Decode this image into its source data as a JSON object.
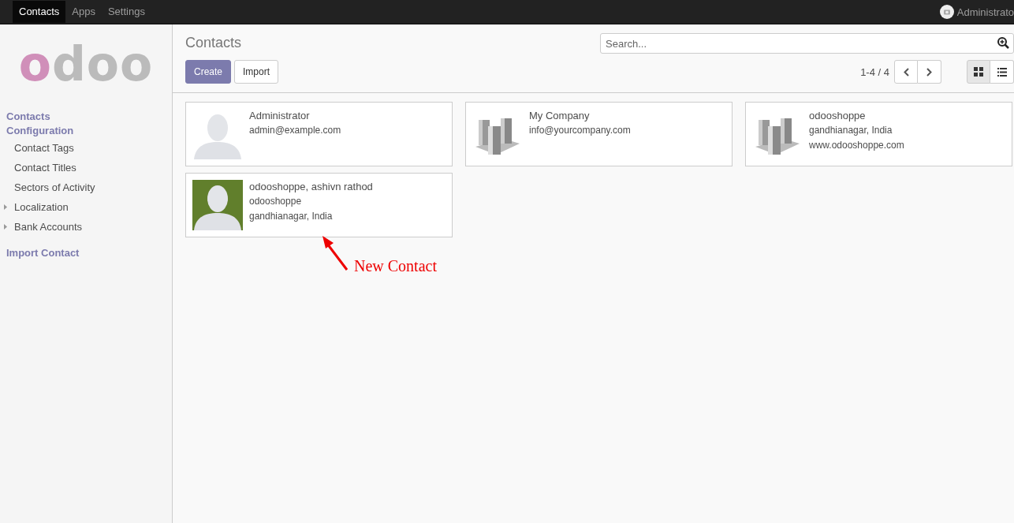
{
  "navbar": {
    "menus": [
      {
        "label": "Contacts",
        "selected": true
      },
      {
        "label": "Apps",
        "selected": false
      },
      {
        "label": "Settings",
        "selected": false
      }
    ],
    "user": "Administrato"
  },
  "sidebar": {
    "logo": "odoo",
    "sections": [
      {
        "kind": "header",
        "label": "Contacts"
      },
      {
        "kind": "header",
        "label": "Configuration"
      },
      {
        "kind": "item",
        "label": "Contact Tags",
        "expandable": false
      },
      {
        "kind": "item",
        "label": "Contact Titles",
        "expandable": false
      },
      {
        "kind": "item",
        "label": "Sectors of Activity",
        "expandable": false
      },
      {
        "kind": "item",
        "label": "Localization",
        "expandable": true
      },
      {
        "kind": "item",
        "label": "Bank Accounts",
        "expandable": true
      },
      {
        "kind": "header",
        "label": "Import Contact"
      }
    ]
  },
  "control_panel": {
    "title": "Contacts",
    "buttons": [
      {
        "label": "Create",
        "kind": "primary"
      },
      {
        "label": "Import",
        "kind": "secondary"
      }
    ],
    "search": {
      "placeholder": "Search..."
    },
    "pager": "1-4 / 4",
    "views": [
      {
        "kind": "kanban",
        "selected": true
      },
      {
        "kind": "list",
        "selected": false
      }
    ]
  },
  "cards": [
    {
      "kind": "person",
      "lines": [
        "Administrator",
        "admin@example.com"
      ]
    },
    {
      "kind": "company",
      "lines": [
        "My Company",
        "info@yourcompany.com"
      ]
    },
    {
      "kind": "company",
      "lines": [
        "odooshoppe",
        "gandhianagar, India",
        "www.odooshoppe.com"
      ]
    },
    {
      "lines": [
        "odooshoppe, ashivn rathod",
        "odooshoppe",
        "gandhianagar, India"
      ]
    }
  ],
  "annotation": {
    "text": "New Contact"
  }
}
